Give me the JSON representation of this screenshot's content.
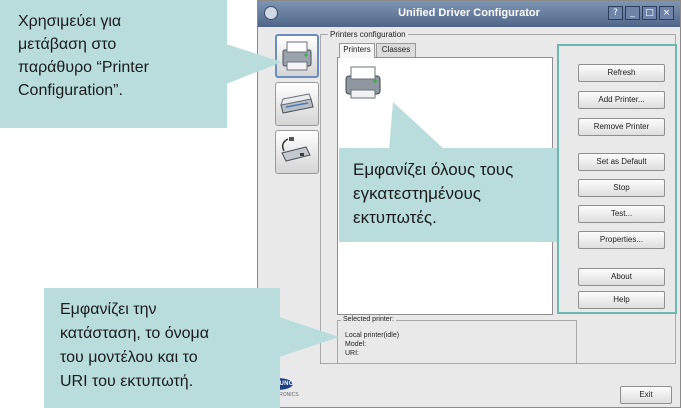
{
  "window": {
    "title": "Unified Driver Configurator",
    "controls": [
      "?",
      "_",
      "□",
      "×"
    ]
  },
  "sidebar": {
    "items": [
      {
        "icon": "printer-icon",
        "selected": true
      },
      {
        "icon": "scanner-icon",
        "selected": false
      },
      {
        "icon": "port-icon",
        "selected": false
      }
    ]
  },
  "printers_config": {
    "group_label": "Printers configuration",
    "tabs": [
      {
        "label": "Printers",
        "active": true
      },
      {
        "label": "Classes",
        "active": false
      }
    ],
    "buttons": [
      "Refresh",
      "Add Printer...",
      "Remove Printer",
      "Set as Default",
      "Stop",
      "Test...",
      "Properties...",
      "About",
      "Help"
    ]
  },
  "selected_printer": {
    "label": "Selected printer:",
    "lines": [
      "Local printer(idle)",
      "Model:",
      "URI:"
    ]
  },
  "brand": {
    "logo_text": "SAMSUNG",
    "sub_text": "ELECTRONICS"
  },
  "footer": {
    "exit_label": "Exit"
  },
  "callouts": {
    "top_left": {
      "lines": [
        "Χρησιμεύει για",
        "μετάβαση στο",
        "παράθυρο “Printer",
        "Configuration”."
      ]
    },
    "middle": {
      "lines": [
        "Εμφανίζει όλους τους",
        "εγκατεστημένους",
        "εκτυπωτές."
      ]
    },
    "bottom": {
      "lines": [
        "Εμφανίζει την",
        "κατάσταση, το όνομα",
        "του μοντέλου και το",
        "URI του εκτυπωτή."
      ]
    }
  },
  "colors": {
    "callout_bg": "#b8dddc",
    "frame_highlight": "#6db7b0",
    "titlebar": "#5b7399"
  }
}
